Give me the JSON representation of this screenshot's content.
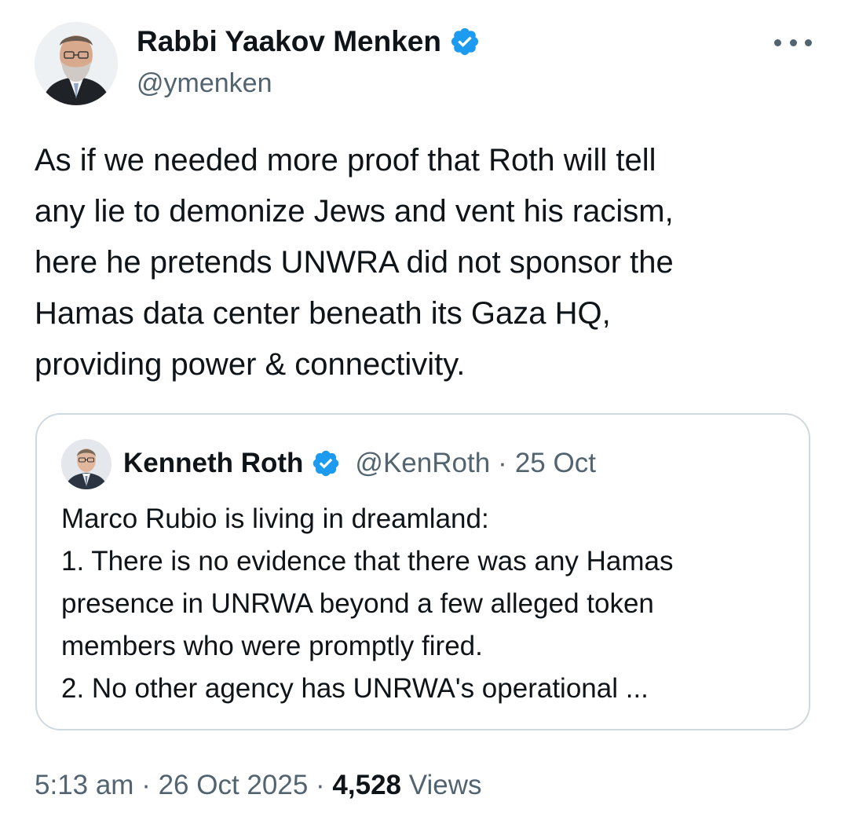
{
  "author": {
    "display_name": "Rabbi Yaakov Menken",
    "handle": "@ymenken",
    "verified": true
  },
  "tweet": {
    "text": "As if we needed more proof that Roth will tell\nany lie to demonize Jews and vent his racism,\nhere he pretends UNWRA did not sponsor the\nHamas data center beneath its Gaza HQ,\nproviding power & connectivity."
  },
  "quoted_tweet": {
    "display_name": "Kenneth Roth",
    "handle": "@KenRoth",
    "separator": "·",
    "date": "25 Oct",
    "verified": true,
    "text": "Marco Rubio is living in dreamland:\n1. There is no evidence that there was any Hamas\npresence in UNRWA beyond a few alleged token\nmembers who were promptly fired.\n2. No other agency has UNRWA's operational ..."
  },
  "meta": {
    "time": "5:13 am",
    "separator": "·",
    "date": "26 Oct 2025",
    "views_count": "4,528",
    "views_label": "Views"
  },
  "colors": {
    "text_primary": "#0f1419",
    "text_secondary": "#536471",
    "verified_badge": "#1d9bf0",
    "border": "#cfd9de"
  },
  "icons": {
    "verified": "verified-badge-icon",
    "more": "more-options-icon"
  }
}
